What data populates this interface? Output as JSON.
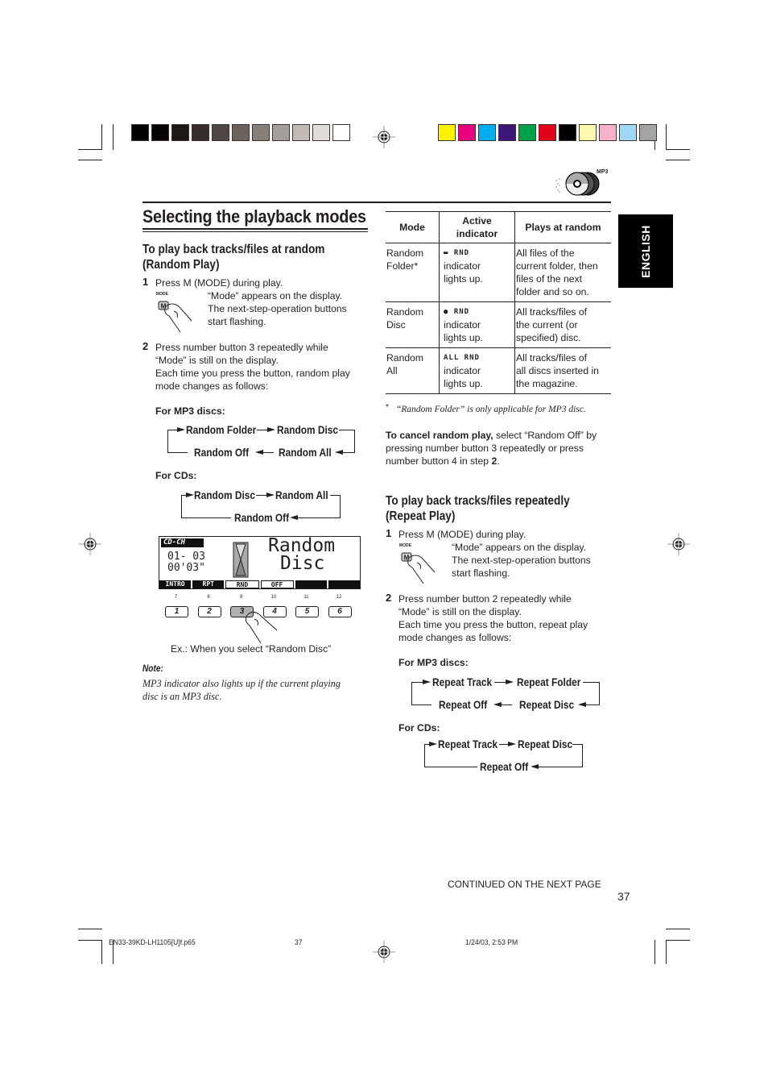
{
  "print_marks": {
    "gray_swatches": [
      "#000000",
      "#050304",
      "#1d1917",
      "#372e2b",
      "#504642",
      "#6b625c",
      "#878079",
      "#a59d97",
      "#c1b9b4",
      "#e0dcd8",
      "#ffffff"
    ],
    "color_swatches": [
      "#fff200",
      "#e6007e",
      "#00aeef",
      "#3c1679",
      "#00a14b",
      "#e2001a",
      "#000000",
      "#fff9b0",
      "#f7b1cb",
      "#9ed8f5",
      "#a4a4a4"
    ]
  },
  "header": {
    "media_badge": "MP3"
  },
  "side_tab": {
    "label": "ENGLISH"
  },
  "page": {
    "title": "Selecting the playback modes",
    "number": "37",
    "continued": "CONTINUED ON THE NEXT PAGE"
  },
  "random_section": {
    "heading_line1": "To play back tracks/files at random",
    "heading_line2": "(Random Play)",
    "step1": {
      "num": "1",
      "text": "Press M (MODE) during play.",
      "button_caption": "MODE",
      "button_letter": "M",
      "detail_lines": [
        "“Mode” appears on the display.",
        "The next-step-operation buttons",
        "start flashing."
      ]
    },
    "step2": {
      "num": "2",
      "lines": [
        "Press number button 3 repeatedly while",
        "“Mode” is still on the display.",
        "Each time you press the button, random play",
        "mode changes as follows:"
      ]
    },
    "mp3_label": "For MP3 discs:",
    "mp3_cycle": [
      "Random Folder",
      "Random Disc",
      "Random All",
      "Random Off"
    ],
    "cd_label": "For CDs:",
    "cd_cycle": [
      "Random Disc",
      "Random All",
      "Random Off"
    ],
    "lcd": {
      "source": "CD-CH",
      "track": "01- 03",
      "time": "00'03\"",
      "message_line1": "Random",
      "message_line2": "Disc",
      "soft_buttons": [
        "INTRO",
        "RPT",
        "RND",
        "OFF",
        "",
        ""
      ]
    },
    "number_buttons": [
      {
        "top": "7",
        "label": "1"
      },
      {
        "top": "8",
        "label": "2"
      },
      {
        "top": "9",
        "label": "3",
        "pressed": true
      },
      {
        "top": "10",
        "label": "4"
      },
      {
        "top": "11",
        "label": "5"
      },
      {
        "top": "12",
        "label": "6"
      }
    ],
    "example_caption": "Ex.:  When you select “Random Disc”",
    "note_label": "Note:",
    "note_lines": [
      "MP3 indicator also lights up if the current playing",
      "disc is an MP3 disc."
    ]
  },
  "modes_table": {
    "headers": [
      "Mode",
      "Active indicator",
      "Plays at random"
    ],
    "rows": [
      {
        "mode": [
          "Random",
          "Folder*"
        ],
        "indicator": "▬ RND",
        "indicator_text": [
          "indicator",
          "lights up."
        ],
        "plays": [
          "All files of the",
          "current folder, then",
          "files of the next",
          "folder and so on."
        ]
      },
      {
        "mode": [
          "Random",
          "Disc"
        ],
        "indicator": "● RND",
        "indicator_text": [
          "indicator",
          "lights up."
        ],
        "plays": [
          "All tracks/files of",
          "the current (or",
          "specified) disc."
        ]
      },
      {
        "mode": [
          "Random",
          "All"
        ],
        "indicator": "ALL RND",
        "indicator_text": [
          "indicator",
          "lights up."
        ],
        "plays": [
          "All tracks/files of",
          "all discs inserted in",
          "the magazine."
        ]
      }
    ],
    "footnote_mark": "*",
    "footnote": "“Random Folder” is only applicable for MP3 disc."
  },
  "cancel_note": {
    "bold": "To cancel random play,",
    "rest1": " select “Random Off” by",
    "line2": "pressing number button 3 repeatedly or press",
    "line3_pre": "number button 4 in step ",
    "line3_bold": "2",
    "line3_post": "."
  },
  "repeat_section": {
    "heading_line1": "To play back tracks/files repeatedly",
    "heading_line2": "(Repeat Play)",
    "step1": {
      "num": "1",
      "text": "Press M (MODE) during play.",
      "button_caption": "MODE",
      "button_letter": "M",
      "detail_lines": [
        "“Mode” appears on the display.",
        "The next-step-operation buttons",
        "start flashing."
      ]
    },
    "step2": {
      "num": "2",
      "lines": [
        "Press number button 2 repeatedly while",
        "“Mode” is still on the display.",
        "Each time you press the button, repeat play",
        "mode changes as follows:"
      ]
    },
    "mp3_label": "For MP3 discs:",
    "mp3_cycle": [
      "Repeat Track",
      "Repeat Folder",
      "Repeat Disc",
      "Repeat Off"
    ],
    "cd_label": "For CDs:",
    "cd_cycle": [
      "Repeat Track",
      "Repeat Disc",
      "Repeat Off"
    ]
  },
  "footer": {
    "file": "EN33-39KD-LH1105[U]f.p65",
    "page": "37",
    "datetime": "1/24/03, 2:53 PM"
  }
}
